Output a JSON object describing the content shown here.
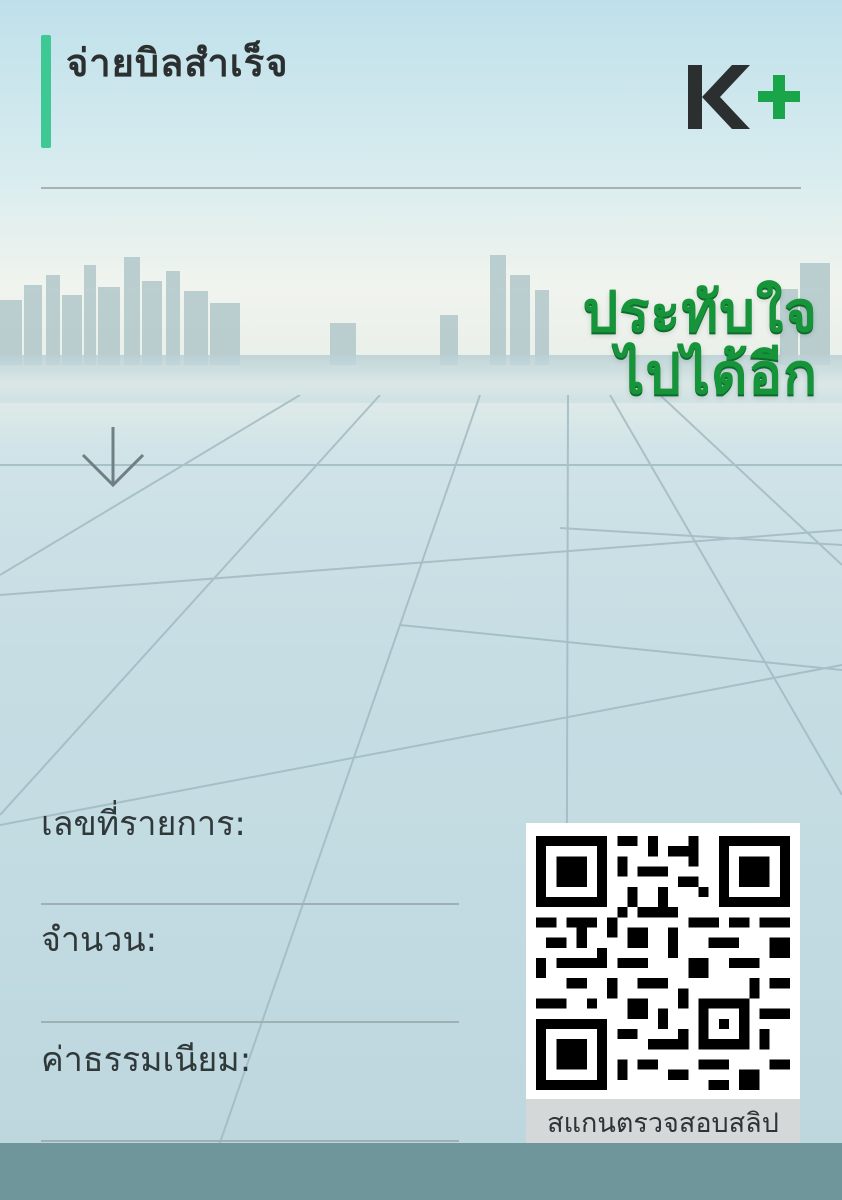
{
  "header": {
    "title": "จ่ายบิลสำเร็จ",
    "logo_text": "K+"
  },
  "banner": {
    "slogan_line1": "ประทับใจ",
    "slogan_line2": "ไปได้อีก"
  },
  "fields": [
    {
      "label": "เลขที่รายการ:",
      "value": ""
    },
    {
      "label": "จำนวน:",
      "value": ""
    },
    {
      "label": "ค่าธรรมเนียม:",
      "value": ""
    }
  ],
  "qr": {
    "caption": "สแกนตรวจสอบสลิป"
  },
  "colors": {
    "accent": "#3ec894",
    "brand_green": "#16943a",
    "footer": "#6e969b"
  },
  "icons": {
    "arrow": "arrow-down-icon",
    "qr": "qr-code-icon"
  }
}
